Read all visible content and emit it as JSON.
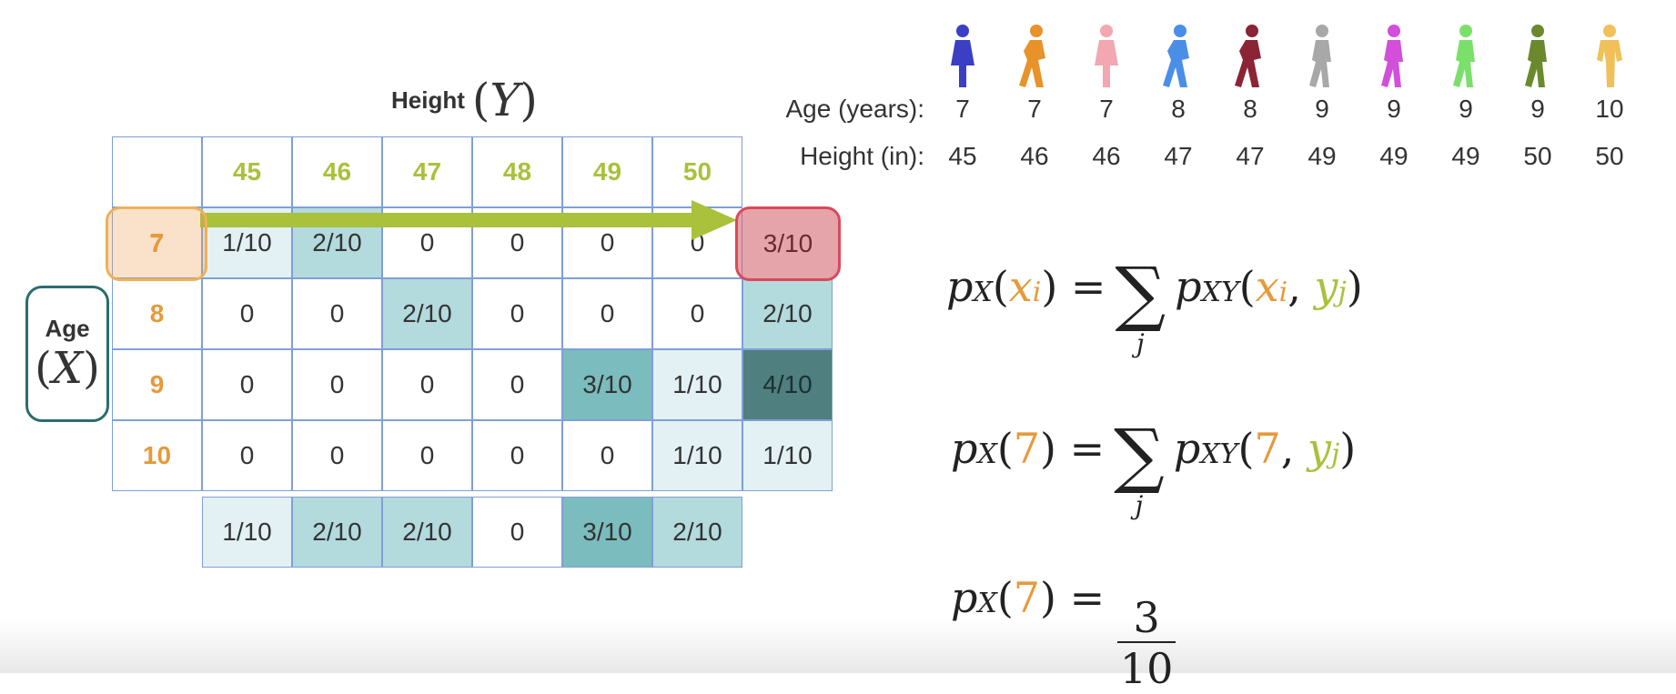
{
  "table": {
    "title_word": "Height",
    "title_var": "Y",
    "row_title_word": "Age",
    "row_title_var": "X",
    "columns": [
      "45",
      "46",
      "47",
      "48",
      "49",
      "50"
    ],
    "rows": [
      {
        "label": "7",
        "cells": [
          "1/10",
          "2/10",
          "0",
          "0",
          "0",
          "0"
        ],
        "marginal": "3/10"
      },
      {
        "label": "8",
        "cells": [
          "0",
          "0",
          "2/10",
          "0",
          "0",
          "0"
        ],
        "marginal": "2/10"
      },
      {
        "label": "9",
        "cells": [
          "0",
          "0",
          "0",
          "0",
          "3/10",
          "1/10"
        ],
        "marginal": "4/10"
      },
      {
        "label": "10",
        "cells": [
          "0",
          "0",
          "0",
          "0",
          "0",
          "1/10"
        ],
        "marginal": "1/10"
      }
    ],
    "column_marginals": [
      "1/10",
      "2/10",
      "2/10",
      "0",
      "3/10",
      "2/10"
    ]
  },
  "people": {
    "age_label": "Age (years):",
    "height_label": "Height (in):",
    "ages": [
      "7",
      "7",
      "7",
      "8",
      "8",
      "9",
      "9",
      "9",
      "9",
      "10"
    ],
    "heights": [
      "45",
      "46",
      "46",
      "47",
      "47",
      "49",
      "49",
      "49",
      "50",
      "50"
    ],
    "colors": [
      "#3a3fc4",
      "#e8922a",
      "#f3a7b0",
      "#4a8ee8",
      "#8b2434",
      "#a8a8a8",
      "#d24fd9",
      "#7be06a",
      "#6b8a2e",
      "#f0c15a"
    ]
  },
  "formulas": {
    "f1_lhs_arg": "x",
    "f1_lhs_sub": "i",
    "f1_rhs_args_x": "x",
    "f1_rhs_args_y": "y",
    "f1_sum_index": "j",
    "f2_lhs_arg": "7",
    "f2_rhs_arg": "7",
    "f2_sum_index": "j",
    "f3_lhs_arg": "7",
    "f3_num": "3",
    "f3_den": "10"
  },
  "colors": {
    "row_header": "#e69a3a",
    "col_header": "#a9c13b",
    "arrow": "#a9c13b",
    "highlight_row": "#efb057",
    "highlight_marginal": "#d9495a",
    "age_box": "#2b6d6d"
  }
}
